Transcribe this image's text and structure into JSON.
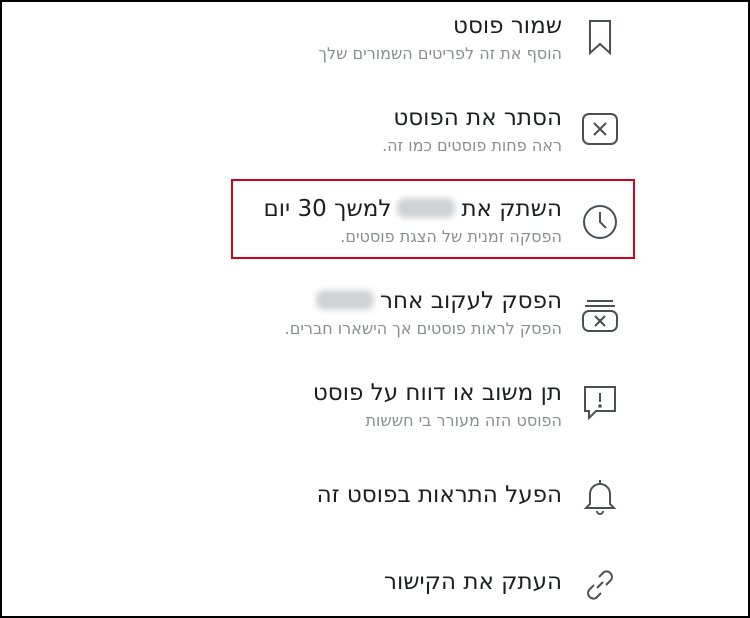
{
  "menu": {
    "items": [
      {
        "title": "שמור פוסט",
        "subtitle": "הוסף את זה לפריטים השמורים שלך",
        "icon": "bookmark-icon"
      },
      {
        "title": "הסתר את הפוסט",
        "subtitle": "ראה פחות פוסטים כמו זה.",
        "icon": "hide-x-icon"
      },
      {
        "title_before": "השתק את",
        "title_after": "למשך 30 יום",
        "subtitle": "הפסקה זמנית של הצגת פוסטים.",
        "icon": "clock-icon"
      },
      {
        "title_before": "הפסק לעקוב אחר",
        "subtitle": "הפסק לראות פוסטים אך הישארו חברים.",
        "icon": "unfollow-icon"
      },
      {
        "title": "תן משוב או דווח על פוסט",
        "subtitle": "הפוסט הזה מעורר בי חששות",
        "icon": "report-icon"
      },
      {
        "title": "הפעל התראות בפוסט זה",
        "icon": "bell-icon"
      },
      {
        "title": "העתק את הקישור",
        "icon": "link-icon"
      }
    ]
  },
  "colors": {
    "highlight": "#d0021b",
    "title": "#1c1e21",
    "subtitle": "#8a8d91",
    "icon": "#4b4f56"
  }
}
